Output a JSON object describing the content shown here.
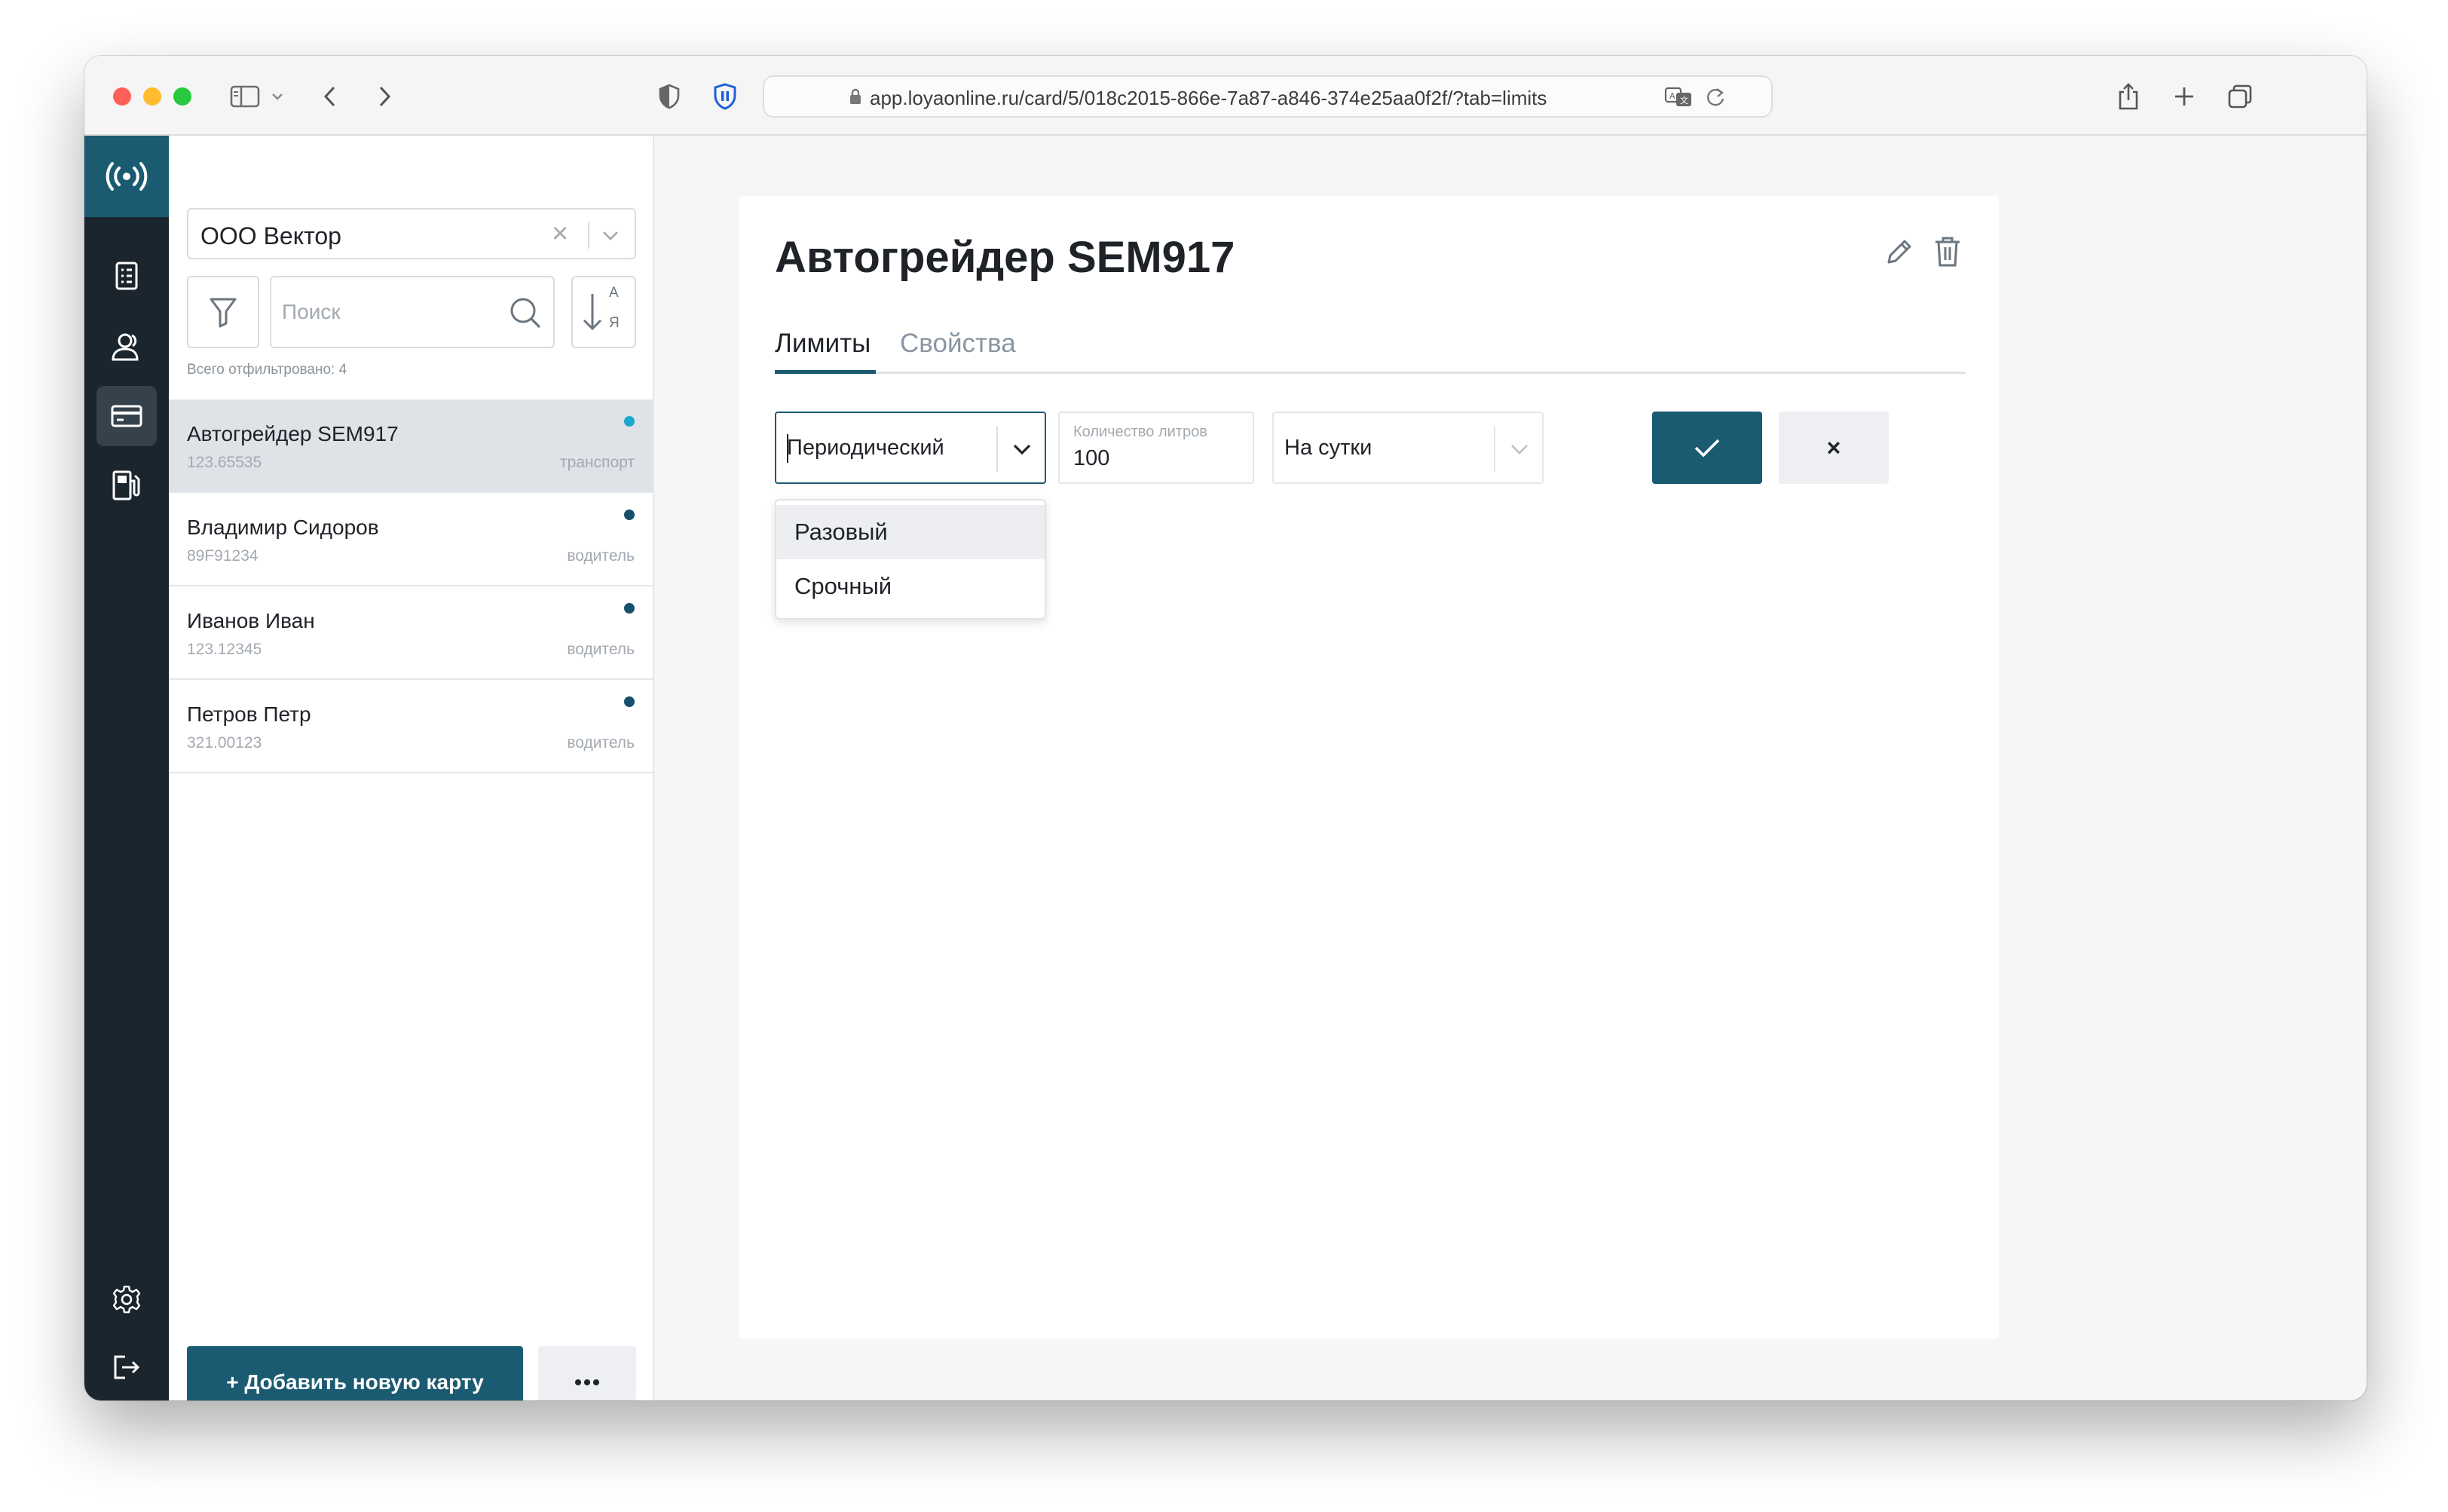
{
  "browser": {
    "url": "app.loyaonline.ru/card/5/018c2015-866e-7a87-a846-374e25aa0f2f/?tab=limits"
  },
  "sidebar_rail": {
    "items": [
      "logo",
      "documents",
      "users",
      "cards",
      "fuel-station",
      "settings",
      "logout"
    ],
    "active": "cards"
  },
  "panel": {
    "organization": "ООО Вектор",
    "search_placeholder": "Поиск",
    "sort_label_top": "А",
    "sort_label_bottom": "Я",
    "filtered_count": "Всего отфильтровано: 4",
    "cards": [
      {
        "name": "Автогрейдер SEM917",
        "number": "123.65535",
        "kind": "транспорт",
        "selected": true
      },
      {
        "name": "Владимир Сидоров",
        "number": "89F91234",
        "kind": "водитель",
        "selected": false
      },
      {
        "name": "Иванов Иван",
        "number": "123.12345",
        "kind": "водитель",
        "selected": false
      },
      {
        "name": "Петров Петр",
        "number": "321.00123",
        "kind": "водитель",
        "selected": false
      }
    ],
    "add_button": "+ Добавить новую карту",
    "more_button": "•••"
  },
  "main": {
    "title": "Автогрейдер SEM917",
    "tabs": [
      {
        "label": "Лимиты",
        "active": true
      },
      {
        "label": "Свойства",
        "active": false
      }
    ],
    "limit_form": {
      "limit_type": "Периодический",
      "liters_label": "Количество литров",
      "liters_value": "100",
      "period": "На сутки",
      "cancel_symbol": "×"
    },
    "limit_type_options": [
      "Разовый",
      "Срочный"
    ],
    "highlighted_option": "Разовый"
  },
  "colors": {
    "accent": "#1b5b72",
    "rail": "#1b252e",
    "selected_row": "#dfe3e8",
    "status_dot_active": "#1ba9cb",
    "status_dot": "#17506b"
  }
}
